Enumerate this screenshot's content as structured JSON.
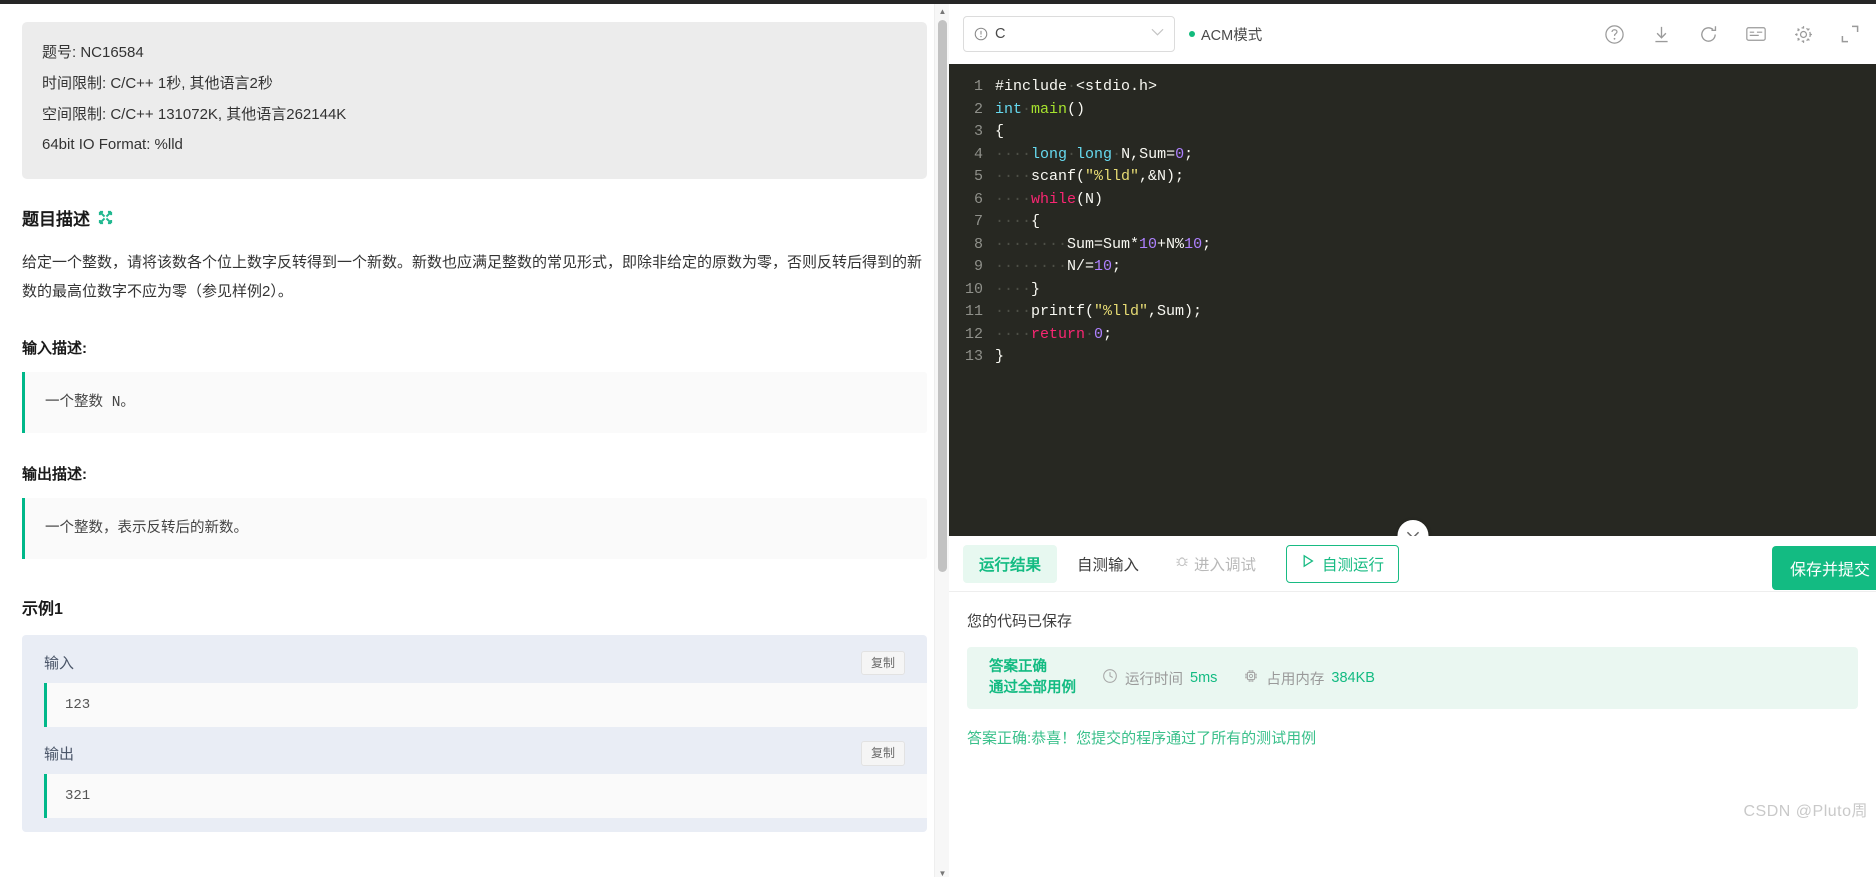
{
  "problem": {
    "meta": [
      "题号:  NC16584",
      "时间限制:  C/C++ 1秒, 其他语言2秒",
      "空间限制:  C/C++ 131072K, 其他语言262144K",
      "64bit IO Format: %lld"
    ],
    "description_title": "题目描述",
    "expand_icon": "expand-arrows-icon",
    "description": "给定一个整数，请将该数各个位上数字反转得到一个新数。新数也应满足整数的常见形式，即除非给定的原数为零，否则反转后得到的新数的最高位数字不应为零（参见样例2）。",
    "input_title": "输入描述:",
    "input_desc": "一个整数 N。",
    "output_title": "输出描述:",
    "output_desc": "一个整数，表示反转后的新数。",
    "example_title": "示例1",
    "example": {
      "input_label": "输入",
      "input_value": "123",
      "output_label": "输出",
      "output_value": "321",
      "copy_label": "复制"
    }
  },
  "editor": {
    "language": "C",
    "language_warn_icon": "exclamation-circle-icon",
    "caret_icon": "chevron-down-icon",
    "mode_label": "ACM模式",
    "toolbar_icons": [
      "help-circle-icon",
      "download-icon",
      "refresh-icon",
      "notes-icon",
      "gear-icon",
      "fullscreen-icon"
    ],
    "collapse_icon": "chevron-down-icon",
    "code": [
      {
        "n": "1",
        "tokens": [
          {
            "t": "#include",
            "c": "pp"
          },
          {
            "t": "·",
            "c": "dot"
          },
          {
            "t": "<stdio.h>",
            "c": "ct"
          }
        ]
      },
      {
        "n": "2",
        "tokens": [
          {
            "t": "int",
            "c": "ty"
          },
          {
            "t": "·",
            "c": "dot"
          },
          {
            "t": "main",
            "c": "fn"
          },
          {
            "t": "()",
            "c": "ct"
          }
        ]
      },
      {
        "n": "3",
        "tokens": [
          {
            "t": "{",
            "c": "ct"
          }
        ]
      },
      {
        "n": "4",
        "tokens": [
          {
            "t": "····",
            "c": "dot"
          },
          {
            "t": "long",
            "c": "ty"
          },
          {
            "t": "·",
            "c": "dot"
          },
          {
            "t": "long",
            "c": "ty"
          },
          {
            "t": "·",
            "c": "dot"
          },
          {
            "t": "N,Sum=",
            "c": "ct"
          },
          {
            "t": "0",
            "c": "nm"
          },
          {
            "t": ";",
            "c": "ct"
          }
        ]
      },
      {
        "n": "5",
        "tokens": [
          {
            "t": "····",
            "c": "dot"
          },
          {
            "t": "scanf(",
            "c": "ct"
          },
          {
            "t": "\"%lld\"",
            "c": "st"
          },
          {
            "t": ",&N);",
            "c": "ct"
          }
        ]
      },
      {
        "n": "6",
        "tokens": [
          {
            "t": "····",
            "c": "dot"
          },
          {
            "t": "while",
            "c": "kw"
          },
          {
            "t": "(N)",
            "c": "ct"
          }
        ]
      },
      {
        "n": "7",
        "tokens": [
          {
            "t": "····",
            "c": "dot"
          },
          {
            "t": "{",
            "c": "ct"
          }
        ]
      },
      {
        "n": "8",
        "tokens": [
          {
            "t": "········",
            "c": "dot"
          },
          {
            "t": "Sum=Sum*",
            "c": "ct"
          },
          {
            "t": "10",
            "c": "nm"
          },
          {
            "t": "+N%",
            "c": "ct"
          },
          {
            "t": "10",
            "c": "nm"
          },
          {
            "t": ";",
            "c": "ct"
          }
        ]
      },
      {
        "n": "9",
        "tokens": [
          {
            "t": "········",
            "c": "dot"
          },
          {
            "t": "N/=",
            "c": "ct"
          },
          {
            "t": "10",
            "c": "nm"
          },
          {
            "t": ";",
            "c": "ct"
          }
        ]
      },
      {
        "n": "10",
        "tokens": [
          {
            "t": "····",
            "c": "dot"
          },
          {
            "t": "}",
            "c": "ct"
          }
        ]
      },
      {
        "n": "11",
        "tokens": [
          {
            "t": "····",
            "c": "dot"
          },
          {
            "t": "printf(",
            "c": "ct"
          },
          {
            "t": "\"%lld\"",
            "c": "st"
          },
          {
            "t": ",Sum);",
            "c": "ct"
          }
        ]
      },
      {
        "n": "12",
        "tokens": [
          {
            "t": "····",
            "c": "dot"
          },
          {
            "t": "return",
            "c": "kw"
          },
          {
            "t": "·",
            "c": "dot"
          },
          {
            "t": "0",
            "c": "nm"
          },
          {
            "t": ";",
            "c": "ct"
          }
        ]
      },
      {
        "n": "13",
        "tokens": [
          {
            "t": "}",
            "c": "ct"
          }
        ]
      }
    ]
  },
  "result": {
    "tabs": [
      {
        "label": "运行结果",
        "state": "active"
      },
      {
        "label": "自测输入",
        "state": "normal"
      },
      {
        "label": "进入调试",
        "state": "dim",
        "icon": "bug-icon"
      }
    ],
    "run_button": {
      "label": "自测运行",
      "icon": "play-icon"
    },
    "submit_button": "保存并提交",
    "saved_text": "您的代码已保存",
    "verdict": {
      "line1": "答案正确",
      "line2": "通过全部用例",
      "time_label": "运行时间",
      "time_value": "5ms",
      "time_icon": "clock-icon",
      "mem_label": "占用内存",
      "mem_value": "384KB",
      "mem_icon": "chip-icon"
    },
    "final_message": "答案正确:恭喜！您提交的程序通过了所有的测试用例"
  },
  "watermark": "CSDN @Pluto周",
  "colors": {
    "accent_green": "#13bb82",
    "editor_bg": "#272822",
    "example_bg": "#e9edf5"
  }
}
